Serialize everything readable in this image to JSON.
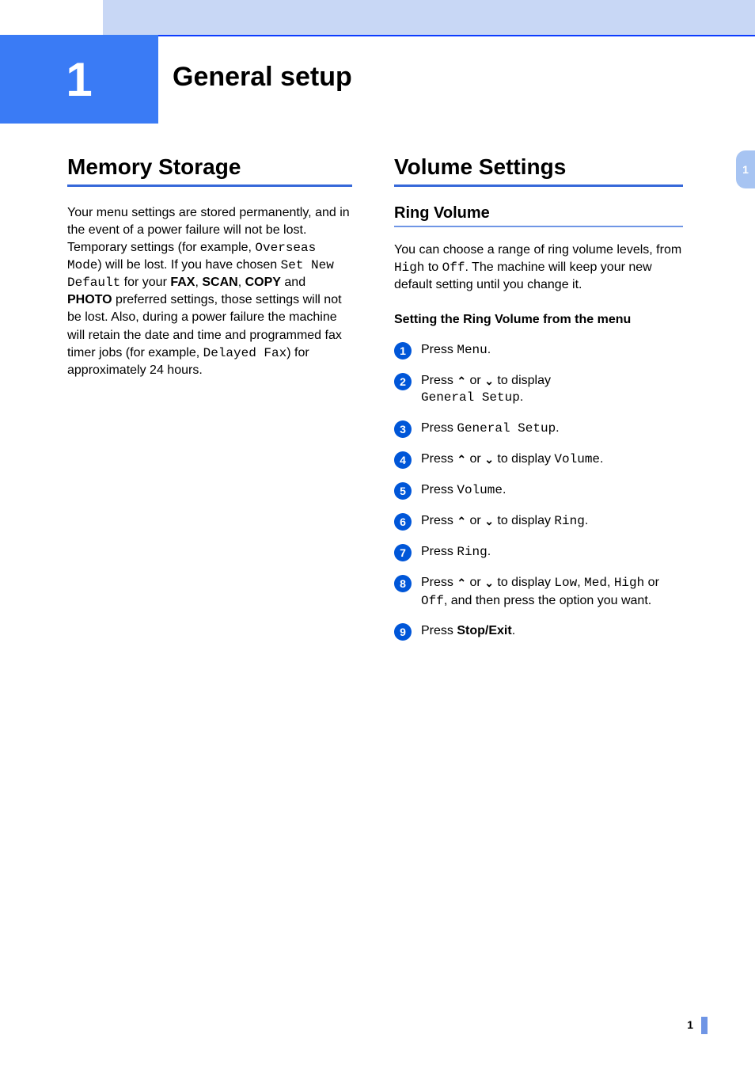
{
  "chapter": {
    "number": "1",
    "title": "General setup",
    "sideTab": "1"
  },
  "left": {
    "heading": "Memory Storage",
    "para": {
      "t1": "Your menu settings are stored permanently, and in the event of a power failure will not be lost. Temporary settings (for example, ",
      "mono1": "Overseas Mode",
      "t2": ") will be lost. If you have chosen ",
      "mono2": "Set New Default",
      "t3": " for your ",
      "b1": "FAX",
      "t4": ", ",
      "b2": "SCAN",
      "t5": ", ",
      "b3": "COPY",
      "t6": " and ",
      "b4": "PHOTO",
      "t7": " preferred settings, those settings will not be lost. Also, during a power failure the machine will retain the date and time and programmed fax timer jobs (for example, ",
      "mono3": "Delayed Fax",
      "t8": ") for approximately 24 hours."
    }
  },
  "right": {
    "heading": "Volume Settings",
    "sub": {
      "heading": "Ring Volume",
      "para": {
        "t1": "You can choose a range of ring volume levels, from ",
        "mono1": "High",
        "t2": " to ",
        "mono2": "Off",
        "t3": ". The machine will keep your new default setting until you change it."
      },
      "subsub": "Setting the Ring Volume from the menu",
      "steps": {
        "s1": {
          "a": "Press ",
          "m": "Menu",
          "b": "."
        },
        "s2": {
          "a": "Press ",
          "b": " or ",
          "c": " to display ",
          "m": "General Setup",
          "d": "."
        },
        "s3": {
          "a": "Press ",
          "m": "General Setup",
          "b": "."
        },
        "s4": {
          "a": "Press ",
          "b": " or ",
          "c": " to display ",
          "m": "Volume",
          "d": "."
        },
        "s5": {
          "a": "Press ",
          "m": "Volume",
          "b": "."
        },
        "s6": {
          "a": "Press ",
          "b": " or ",
          "c": " to display ",
          "m": "Ring",
          "d": "."
        },
        "s7": {
          "a": "Press ",
          "m": "Ring",
          "b": "."
        },
        "s8": {
          "a": "Press ",
          "b": " or ",
          "c": " to display ",
          "m1": "Low",
          "d": ", ",
          "m2": "Med",
          "e": ", ",
          "m3": "High",
          "f": " or ",
          "m4": "Off",
          "g": ", and then press the option you want."
        },
        "s9": {
          "a": "Press ",
          "bold": "Stop/Exit",
          "b": "."
        }
      }
    }
  },
  "pageNumber": "1"
}
